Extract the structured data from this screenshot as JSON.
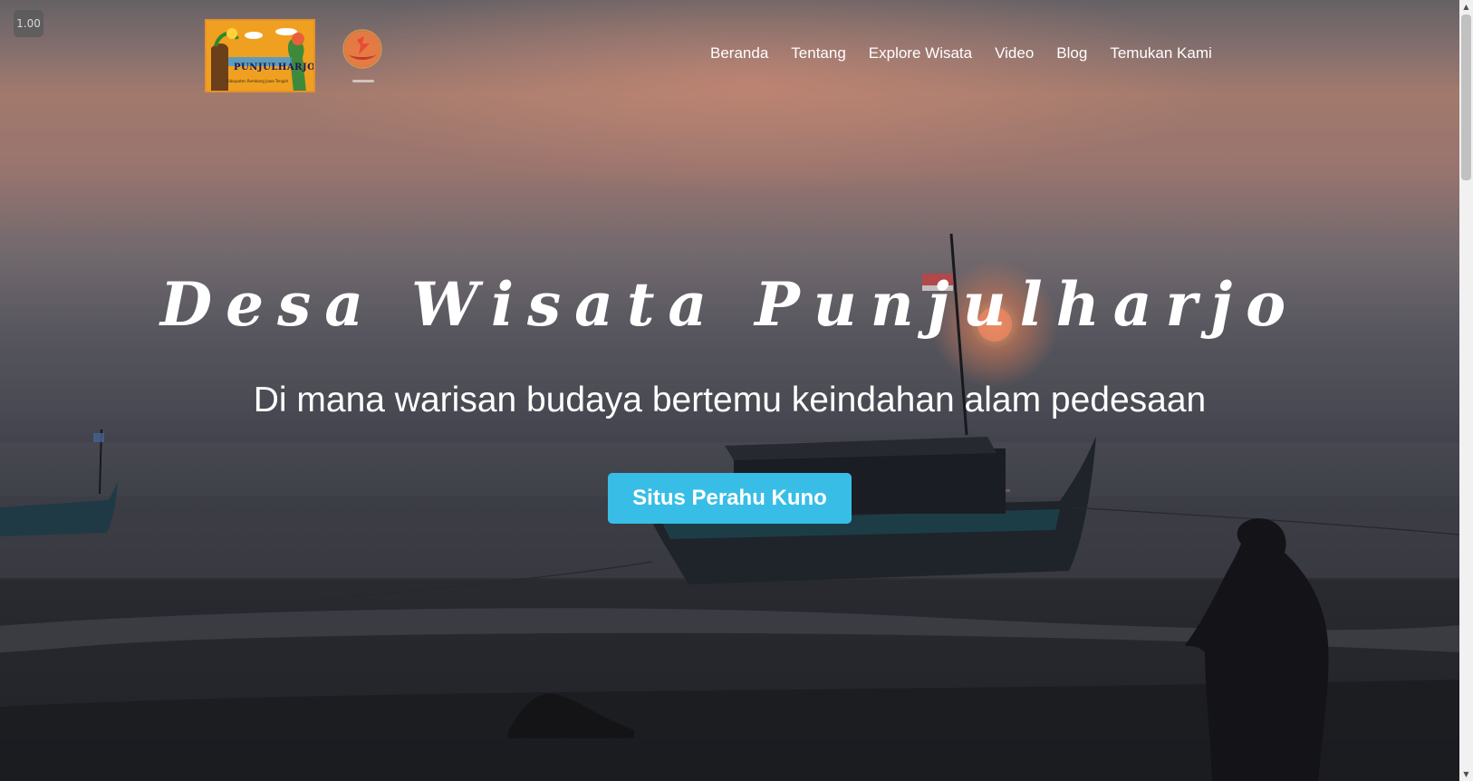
{
  "zoom_badge": "1.00",
  "logo": {
    "title": "PUNJULHARJO",
    "subtitle": "Kabupaten Rembang Jawa Tengah"
  },
  "nav": {
    "items": [
      "Beranda",
      "Tentang",
      "Explore Wisata",
      "Video",
      "Blog",
      "Temukan Kami"
    ]
  },
  "hero": {
    "title": "Desa Wisata Punjulharjo",
    "subtitle": "Di mana warisan budaya bertemu keindahan alam pedesaan",
    "cta_label": "Situs Perahu Kuno"
  },
  "colors": {
    "cta": "#38bee6",
    "text": "#ffffff",
    "sky_top": "#b08577",
    "sea": "#3c3d46"
  }
}
